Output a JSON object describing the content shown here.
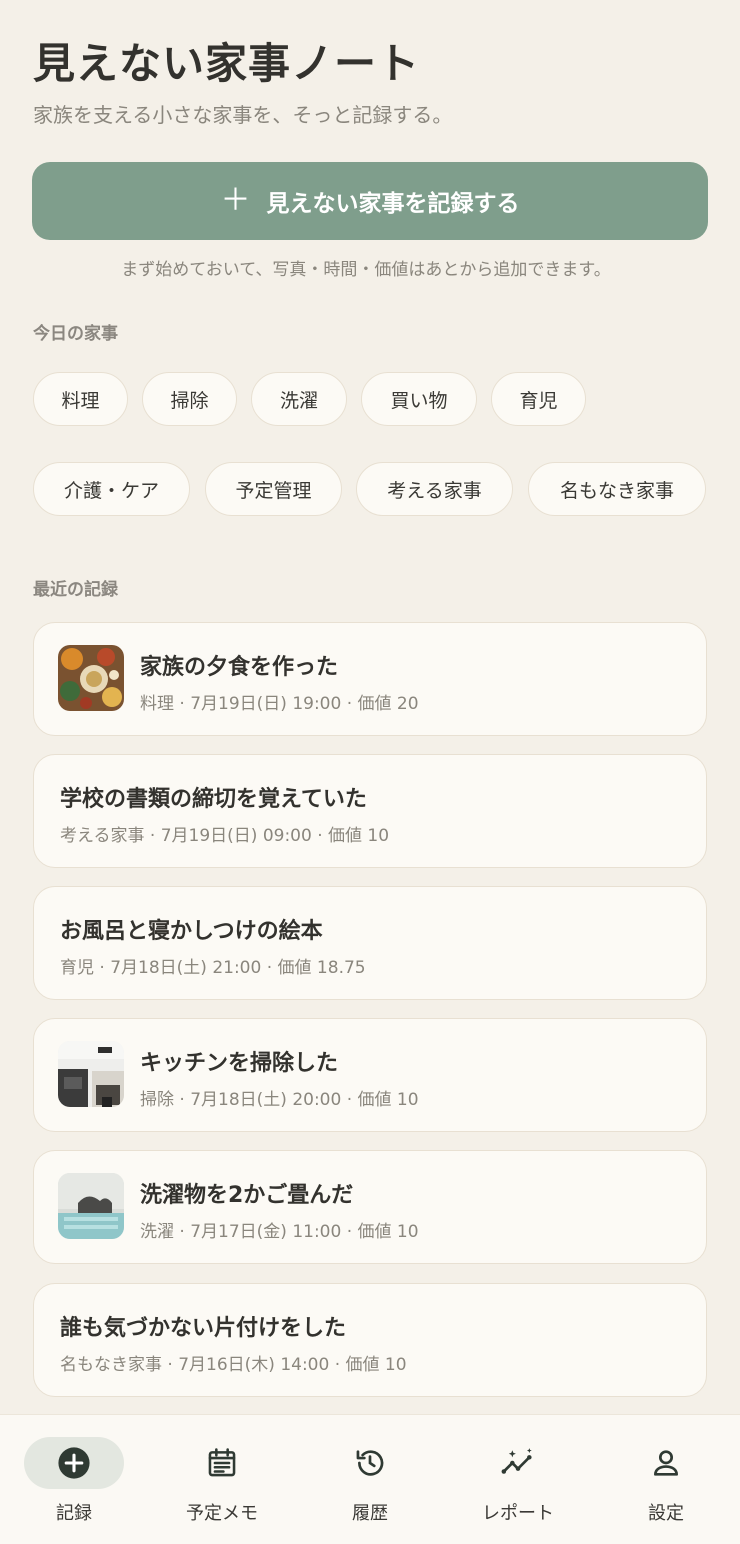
{
  "header": {
    "title": "見えない家事ノート",
    "subtitle": "家族を支える小さな家事を、そっと記録する。"
  },
  "record_button": {
    "icon": "plus-icon",
    "label": "見えない家事を記録する"
  },
  "hint": "まず始めておいて、写真・時間・価値はあとから追加できます。",
  "today": {
    "label": "今日の家事",
    "chips": [
      "料理",
      "掃除",
      "洗濯",
      "買い物",
      "育児",
      "介護・ケア",
      "予定管理",
      "考える家事",
      "名もなき家事"
    ]
  },
  "recent": {
    "label": "最近の記録",
    "items": [
      {
        "title": "家族の夕食を作った",
        "meta": "料理 · 7月19日(日) 19:00 · 価値 20",
        "thumb": "food-photo"
      },
      {
        "title": "学校の書類の締切を覚えていた",
        "meta": "考える家事 · 7月19日(日) 09:00 · 価値 10",
        "thumb": null
      },
      {
        "title": "お風呂と寝かしつけの絵本",
        "meta": "育児 · 7月18日(土) 21:00 · 価値 18.75",
        "thumb": null
      },
      {
        "title": "キッチンを掃除した",
        "meta": "掃除 · 7月18日(土) 20:00 · 価値 10",
        "thumb": "kitchen-photo"
      },
      {
        "title": "洗濯物を2かご畳んだ",
        "meta": "洗濯 · 7月17日(金) 11:00 · 価値 10",
        "thumb": "laundry-photo"
      },
      {
        "title": "誰も気づかない片付けをした",
        "meta": "名もなき家事 · 7月16日(木) 14:00 · 価値 10",
        "thumb": null
      }
    ]
  },
  "nav": {
    "items": [
      {
        "label": "記録",
        "icon": "add-circle-icon",
        "active": true
      },
      {
        "label": "予定メモ",
        "icon": "calendar-note-icon",
        "active": false
      },
      {
        "label": "履歴",
        "icon": "history-icon",
        "active": false
      },
      {
        "label": "レポート",
        "icon": "insights-icon",
        "active": false
      },
      {
        "label": "設定",
        "icon": "person-icon",
        "active": false
      }
    ]
  },
  "colors": {
    "background": "#f4f0e8",
    "accent": "#7f9e8c",
    "card": "#fcfaf5",
    "text": "#33322e",
    "muted": "#8a867d"
  }
}
